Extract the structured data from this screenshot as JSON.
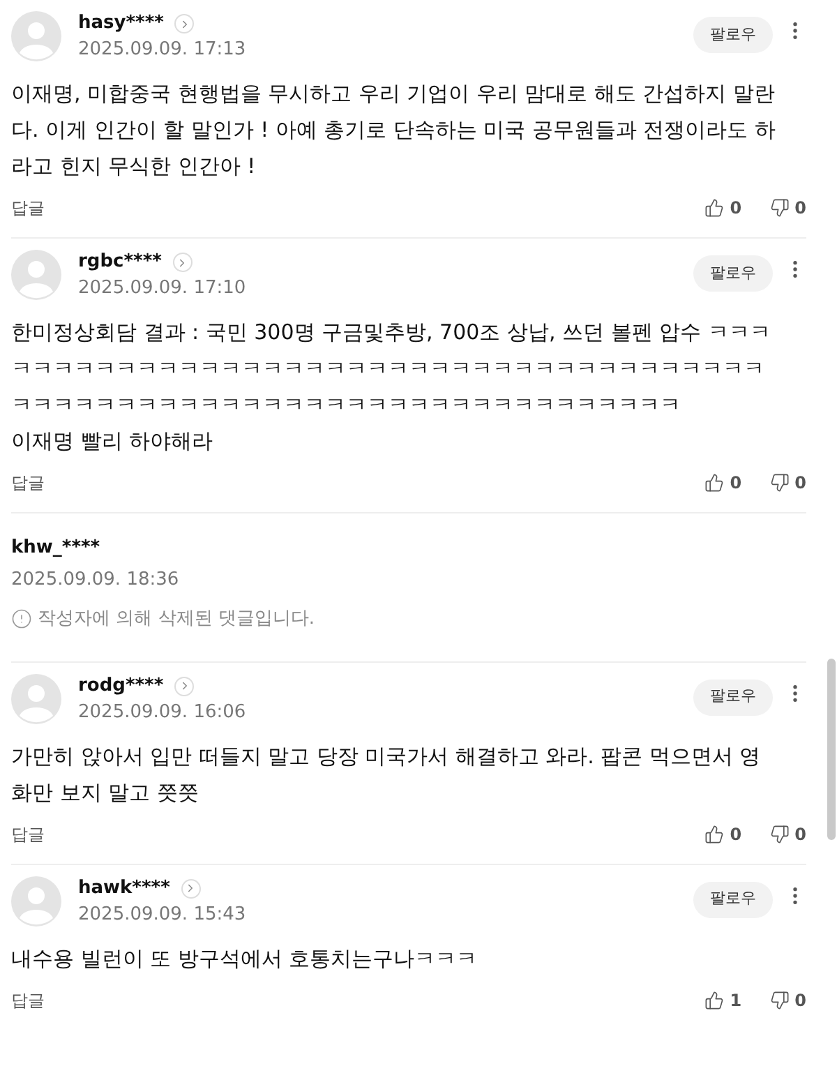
{
  "comments": [
    {
      "kind": "comment",
      "author": "hasy****",
      "date": "2025.09.09. 17:13",
      "follow": "팔로우",
      "body": "이재명, 미합중국 현행법을 무시하고 우리 기업이 우리 맘대로 해도 간섭하지 말란다. 이게 인간이 할 말인가 ! 아예 총기로 단속하는 미국 공무원들과 전쟁이라도 하라고 힌지 무식한 인간아 !",
      "reply": "답글",
      "likes": "0",
      "dislikes": "0"
    },
    {
      "kind": "comment",
      "author": "rgbc****",
      "date": "2025.09.09. 17:10",
      "follow": "팔로우",
      "body": "한미정상회담 결과 : 국민 300명 구금및추방, 700조 상납, 쓰던 볼펜 압수 ㅋㅋㅋㅋㅋㅋㅋㅋㅋㅋㅋㅋㅋㅋㅋㅋㅋㅋㅋㅋㅋㅋㅋㅋㅋㅋㅋㅋㅋㅋㅋㅋㅋㅋㅋㅋㅋㅋㅋㅋㅋㅋㅋㅋㅋㅋㅋㅋㅋㅋㅋㅋㅋㅋㅋㅋㅋㅋㅋㅋㅋㅋㅋㅋㅋㅋㅋㅋㅋㅋㅋ\n이재명 빨리 하야해라",
      "reply": "답글",
      "likes": "0",
      "dislikes": "0"
    },
    {
      "kind": "deleted",
      "author": "khw_****",
      "date": "2025.09.09. 18:36",
      "notice": "작성자에 의해 삭제된 댓글입니다."
    },
    {
      "kind": "comment",
      "author": "rodg****",
      "date": "2025.09.09. 16:06",
      "follow": "팔로우",
      "body": "가만히 앉아서 입만 떠들지 말고 당장 미국가서 해결하고 와라. 팝콘 먹으면서 영화만 보지 말고 쯧쯧",
      "reply": "답글",
      "likes": "0",
      "dislikes": "0"
    },
    {
      "kind": "comment",
      "author": "hawk****",
      "date": "2025.09.09. 15:43",
      "follow": "팔로우",
      "body": "내수용 빌런이 또 방구석에서 호통치는구나ㅋㅋㅋ",
      "reply": "답글",
      "likes": "1",
      "dislikes": "0"
    }
  ]
}
